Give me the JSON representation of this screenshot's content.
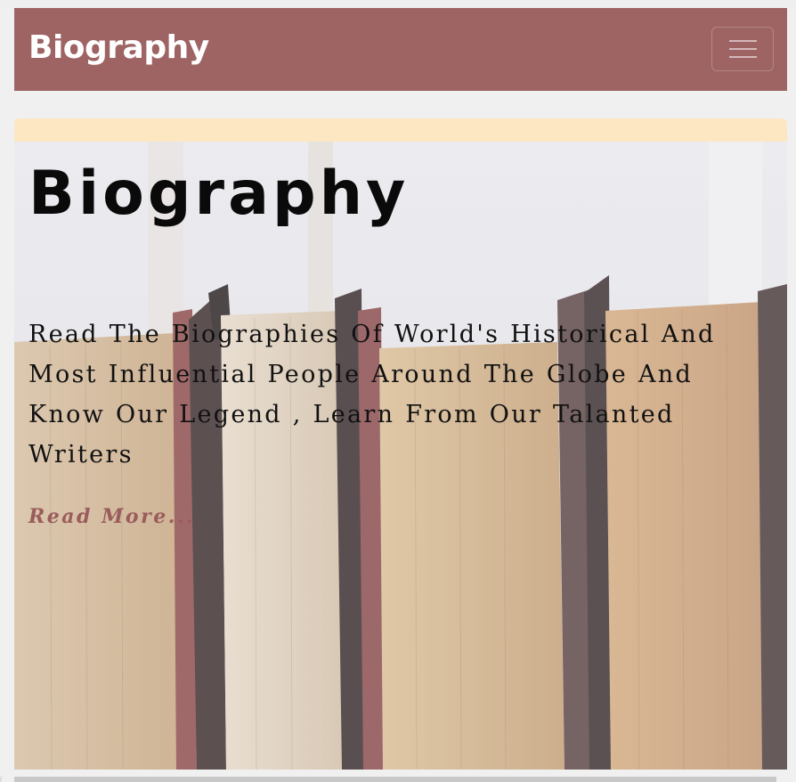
{
  "navbar": {
    "brand": "Biography",
    "toggler_icon": "hamburger-icon",
    "background_color": "#9e6464"
  },
  "hero": {
    "title": "Biography",
    "description": "Read The Biographies Of World's Historical And Most Influential People Around The Globe And Know Our Legend , Learn From Our Talanted Writers",
    "read_more": "Read More...",
    "accent_color": "#fde7c2",
    "link_color": "#9a5c5c"
  }
}
